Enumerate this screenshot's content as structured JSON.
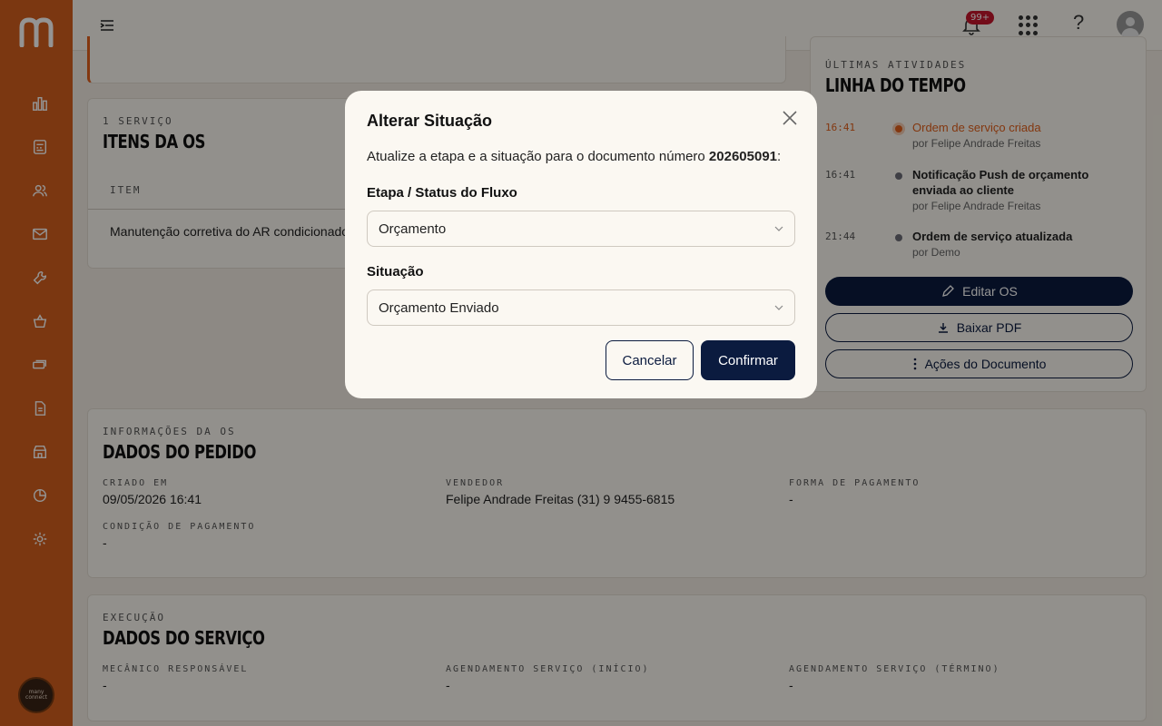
{
  "colors": {
    "brand": "#d4601e",
    "navy": "#0b1b3f",
    "accent_orange": "#e2601b"
  },
  "topbar": {
    "notifications_badge": "99+",
    "help_label": "?"
  },
  "sidebar": {
    "logo_icon": "m-logo-icon",
    "items": [
      "dashboard-icon",
      "calculator-icon",
      "users-icon",
      "mail-icon",
      "wrench-icon",
      "basket-icon",
      "money-icon",
      "document-icon",
      "store-icon",
      "pie-chart-icon",
      "gear-icon"
    ],
    "bottom_logo_text": [
      "many",
      "connect"
    ]
  },
  "items_card": {
    "kicker": "1 Serviço",
    "title": "ITENS DA OS",
    "col_header": "Item",
    "row_text": "Manutenção corretiva do AR condicionado"
  },
  "timeline": {
    "kicker": "Últimas atividades",
    "title": "LINHA DO TEMPO",
    "entries": [
      {
        "time": "16:41",
        "title": "Ordem de serviço criada",
        "by": "por Felipe Andrade Freitas"
      },
      {
        "time": "16:41",
        "title": "Notificação Push de orçamento enviada ao cliente",
        "by": "por Felipe Andrade Freitas"
      },
      {
        "time": "21:44",
        "title": "Ordem de serviço atualizada",
        "by": "por Demo"
      }
    ],
    "edit_button": "Editar OS",
    "pdf_button": "Baixar PDF",
    "actions_button": "Ações do Documento"
  },
  "order_info": {
    "kicker": "Informações da OS",
    "title": "DADOS DO PEDIDO",
    "created_label": "Criado em",
    "created_value": "09/05/2026 16:41",
    "seller_label": "Vendedor",
    "seller_value": "Felipe Andrade Freitas (31) 9 9455-6815",
    "payment_form_label": "Forma de pagamento",
    "payment_form_value": "-",
    "payment_cond_label": "Condição de pagamento",
    "payment_cond_value": "-"
  },
  "service_info": {
    "kicker": "Execução",
    "title": "DADOS DO SERVIÇO",
    "mechanic_label": "Mecânico responsável",
    "mechanic_value": "-",
    "start_label": "Agendamento serviço (início)",
    "start_value": "-",
    "end_label": "Agendamento serviço (término)",
    "end_value": "-"
  },
  "modal": {
    "title": "Alterar Situação",
    "desc_prefix": "Atualize a etapa e a situação para o documento número ",
    "doc_number": "202605091",
    "desc_suffix": ":",
    "stage_label": "Etapa / Status do Fluxo",
    "stage_value": "Orçamento",
    "situation_label": "Situação",
    "situation_value": "Orçamento Enviado",
    "cancel_label": "Cancelar",
    "confirm_label": "Confirmar"
  }
}
